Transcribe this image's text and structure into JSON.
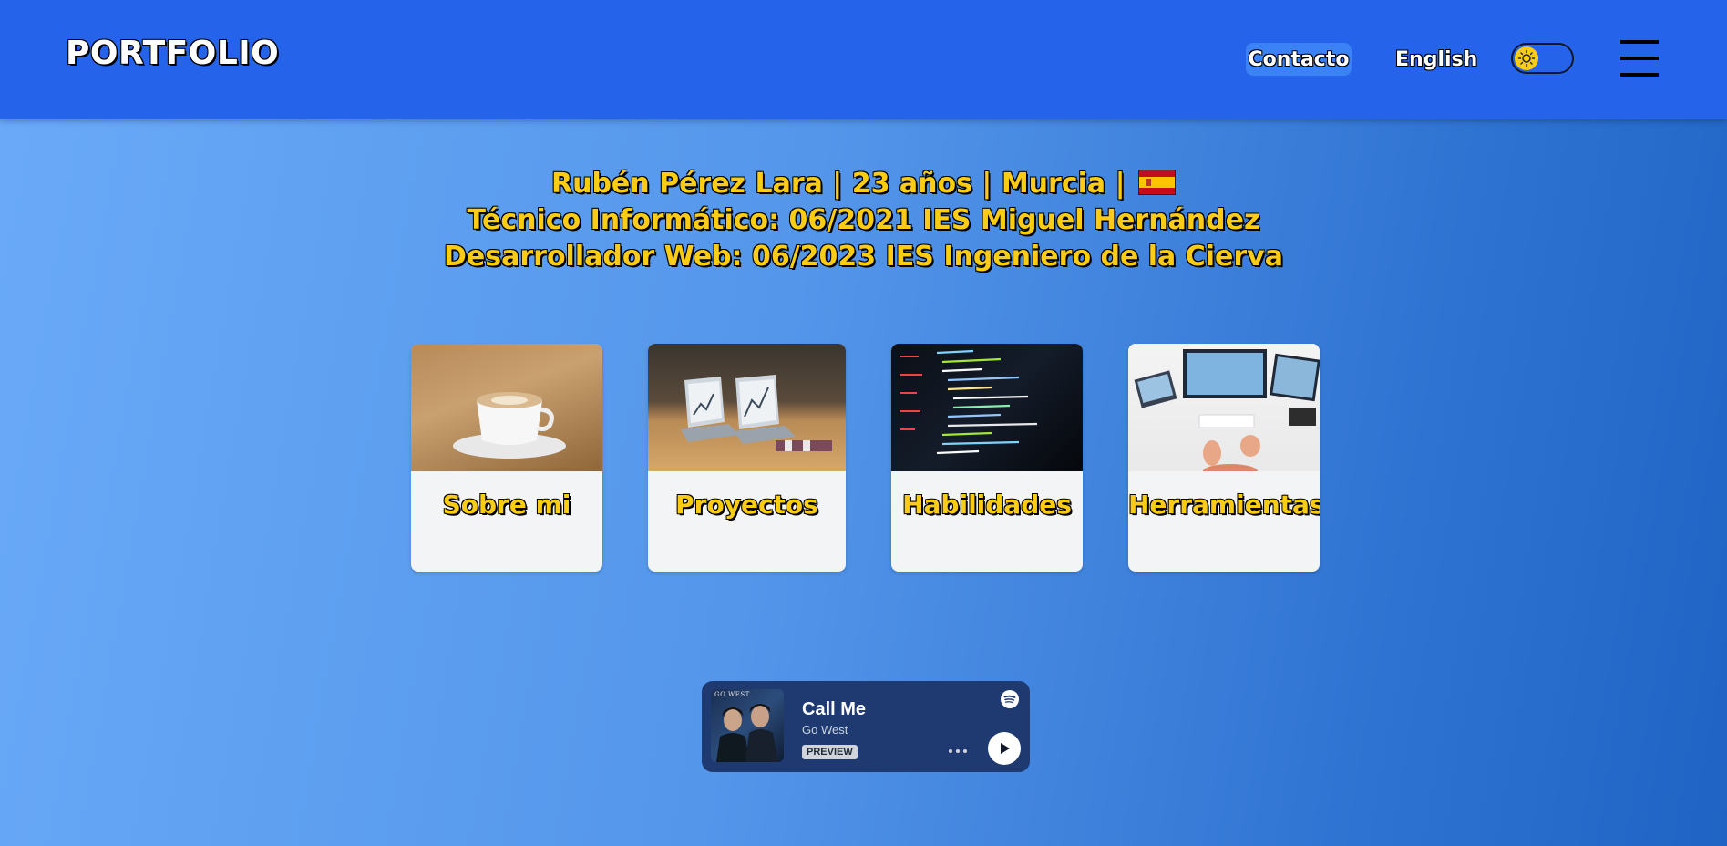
{
  "header": {
    "brand": "PORTFOLIO",
    "contact_label": "Contacto",
    "language_label": "English",
    "theme_icon": "sun-icon",
    "menu_icon": "hamburger-menu-icon"
  },
  "hero": {
    "line1": "Rubén Pérez Lara | 23 años | Murcia |",
    "line2": "Técnico Informático: 06/2021 IES Miguel Hernández",
    "line3": "Desarrollador Web: 06/2023 IES Ingeniero de la Cierva",
    "flag_icon": "spain-flag-icon"
  },
  "cards": [
    {
      "label": "Sobre mi",
      "image": "coffee-cup-image"
    },
    {
      "label": "Proyectos",
      "image": "laptops-desk-image"
    },
    {
      "label": "Habilidades",
      "image": "code-screen-image"
    },
    {
      "label": "Herramientas",
      "image": "workstation-monitors-image"
    }
  ],
  "player": {
    "cover_text": "GO WEST",
    "title": "Call Me",
    "artist": "Go West",
    "badge": "PREVIEW",
    "brand_icon": "spotify-icon",
    "more_icon": "more-dots-icon",
    "play_icon": "play-icon"
  },
  "colors": {
    "navbar": "#2563eb",
    "accent_text": "#facc15",
    "card_bg": "#f3f4f6",
    "player_bg": "#1e3a70"
  }
}
